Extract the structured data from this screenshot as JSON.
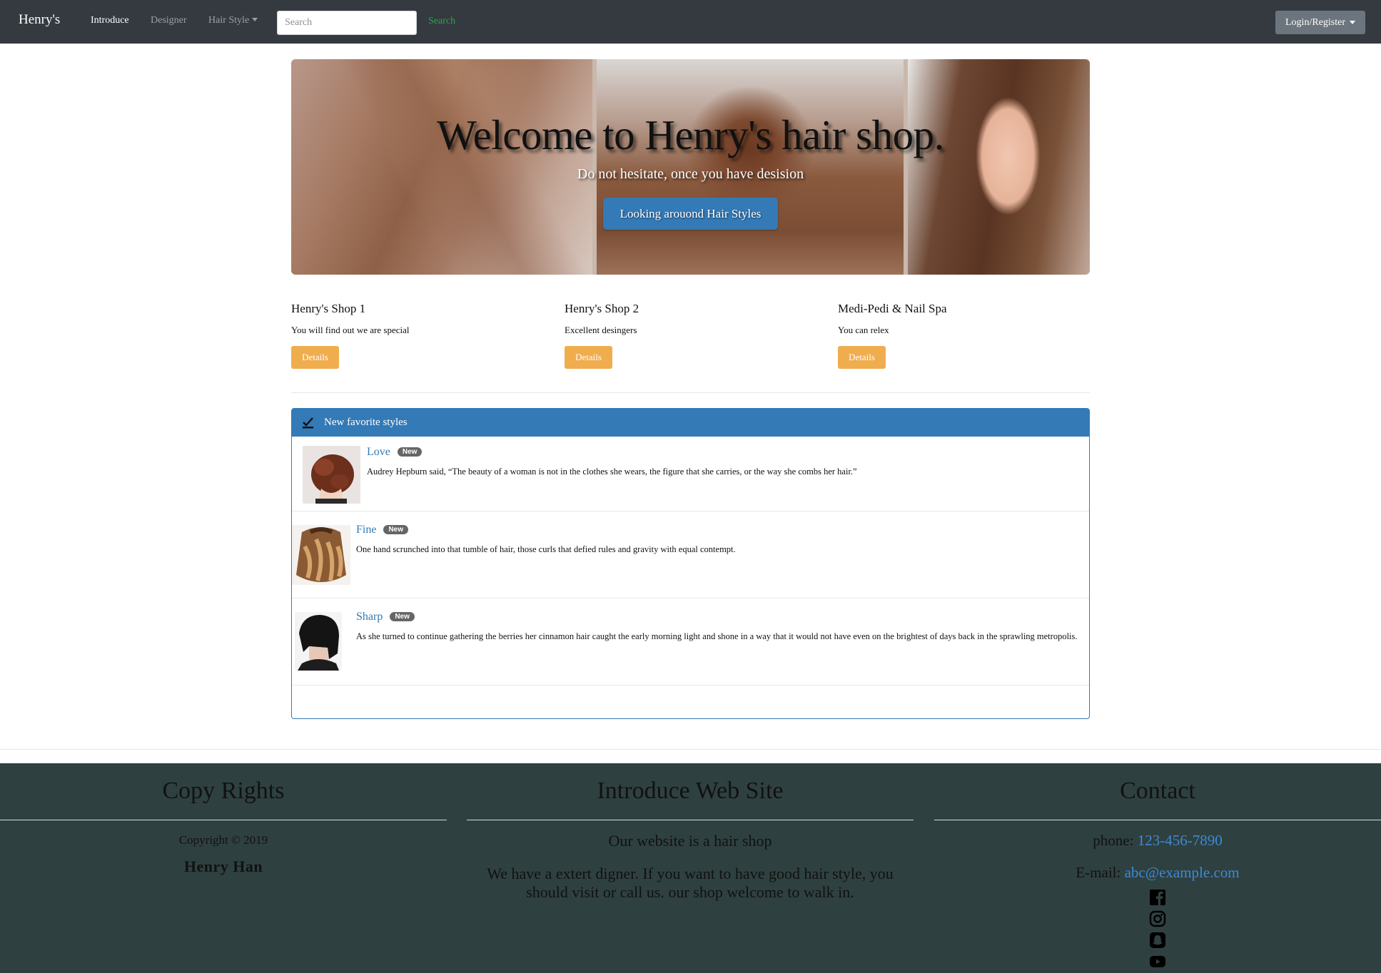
{
  "navbar": {
    "brand": "Henry's",
    "links": [
      {
        "label": "Introduce",
        "active": true
      },
      {
        "label": "Designer",
        "active": false
      },
      {
        "label": "Hair Style",
        "active": false
      }
    ],
    "search_placeholder": "Search",
    "search_button": "Search",
    "login_label": "Login/Register"
  },
  "hero": {
    "title": "Welcome to Henry's hair shop.",
    "subtitle": "Do not hesitate, once you have desision",
    "button": "Looking arouond Hair Styles"
  },
  "shops": [
    {
      "name": "Henry's Shop 1",
      "desc": "You will find out we are special",
      "button": "Details"
    },
    {
      "name": "Henry's Shop 2",
      "desc": "Excellent desingers",
      "button": "Details"
    },
    {
      "name": "Medi-Pedi & Nail Spa",
      "desc": "You can relex",
      "button": "Details"
    }
  ],
  "favorites": {
    "header": "New favorite styles",
    "items": [
      {
        "title": "Love",
        "badge": "New",
        "text": "Audrey Hepburn said, “The beauty of a woman is not in the clothes she wears, the figure that she carries, or the way she combs her hair.”"
      },
      {
        "title": "Fine",
        "badge": "New",
        "text": "One hand scrunched into that tumble of hair, those curls that defied rules and gravity with equal contempt."
      },
      {
        "title": "Sharp",
        "badge": "New",
        "text": "As she turned to continue gathering the berries her cinnamon hair caught the early morning light and shone in a way that it would not have even on the brightest of days back in the sprawling metropolis."
      }
    ]
  },
  "footer": {
    "copy": {
      "heading": "Copy Rights",
      "copyright": "Copyright © 2019",
      "author": "Henry Han"
    },
    "intro": {
      "heading": "Introduce Web Site",
      "line1": "Our website is a hair shop",
      "line2": "We have a extert digner. If you want to have good hair style, you should visit or call us. our shop welcome to walk in."
    },
    "contact": {
      "heading": "Contact",
      "phone_label": "phone:",
      "phone": "123-456-7890",
      "email_label": "E-mail:",
      "email": "abc@example.com"
    },
    "social_icons": [
      "facebook-icon",
      "instagram-icon",
      "snapchat-icon",
      "youtube-icon"
    ]
  },
  "colors": {
    "navbar": "#343a40",
    "primary": "#337ab7",
    "warning": "#f0ad4e",
    "success": "#28a745",
    "footer": "#2f4040",
    "link": "#3d8ad6"
  }
}
